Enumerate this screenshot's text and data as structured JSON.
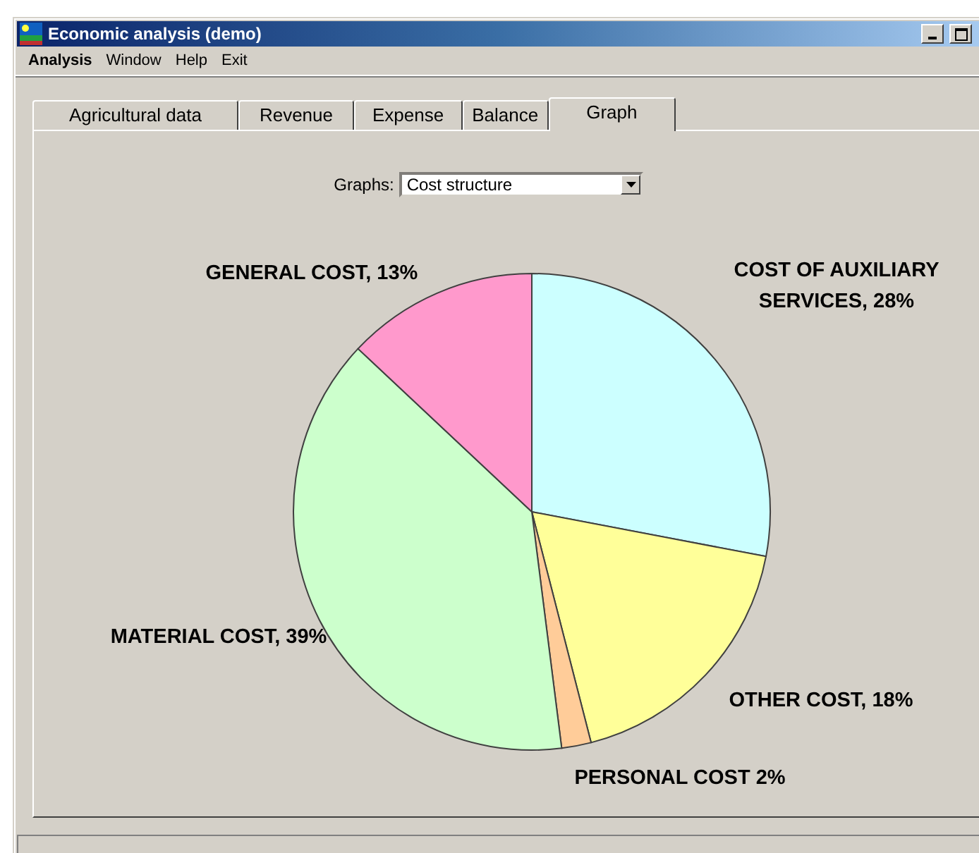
{
  "window": {
    "title": "Economic analysis (demo)"
  },
  "menu": [
    {
      "label": "Analysis",
      "selected": true
    },
    {
      "label": "Window",
      "selected": false
    },
    {
      "label": "Help",
      "selected": false
    },
    {
      "label": "Exit",
      "selected": false
    }
  ],
  "tabs": [
    {
      "label": "Agricultural data",
      "selected": false
    },
    {
      "label": "Revenue",
      "selected": false
    },
    {
      "label": "Expense",
      "selected": false
    },
    {
      "label": "Balance",
      "selected": false
    },
    {
      "label": "Graph",
      "selected": true
    }
  ],
  "graph_select": {
    "label": "Graphs:",
    "value": "Cost structure"
  },
  "chart": {
    "chart_data": {
      "type": "pie",
      "values": [
        28,
        18,
        2,
        39,
        13
      ],
      "colors": [
        "#ccffff",
        "#ffff99",
        "#ffcc99",
        "#ccffcc",
        "#ff99cc"
      ],
      "value_labels": [
        [
          "COST OF AUXILIARY",
          "SERVICES, 28%"
        ],
        [
          "OTHER COST, 18%"
        ],
        [
          "PERSONAL COST 2%"
        ],
        [
          "MATERIAL COST, 39%"
        ],
        [
          "GENERAL COST, 13%"
        ]
      ]
    }
  }
}
